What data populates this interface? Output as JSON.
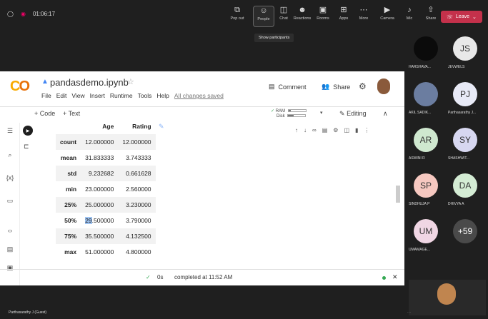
{
  "meeting": {
    "timer": "01:06:17",
    "tools": [
      {
        "icon": "pop-out-icon",
        "glyph": "⧉",
        "label": "Pop out"
      },
      {
        "icon": "people-icon",
        "glyph": "☺",
        "label": "People"
      },
      {
        "icon": "chat-icon",
        "glyph": "◫",
        "label": "Chat"
      },
      {
        "icon": "reactions-icon",
        "glyph": "☻",
        "label": "Reactions"
      },
      {
        "icon": "rooms-icon",
        "glyph": "▣",
        "label": "Rooms"
      },
      {
        "icon": "apps-icon",
        "glyph": "⊞",
        "label": "Apps"
      },
      {
        "icon": "more-icon",
        "glyph": "⋯",
        "label": "More"
      },
      {
        "icon": "camera-icon",
        "glyph": "▶",
        "label": "Camera"
      },
      {
        "icon": "mic-icon",
        "glyph": "♪",
        "label": "Mic"
      },
      {
        "icon": "share-icon",
        "glyph": "⇧",
        "label": "Share"
      }
    ],
    "leave_label": "Leave",
    "tooltip": "Show participants",
    "presenter_label": "Parthasarathy J (Guest)"
  },
  "colab": {
    "title": "pandasdemo.ipynb",
    "menu": [
      "File",
      "Edit",
      "View",
      "Insert",
      "Runtime",
      "Tools",
      "Help"
    ],
    "save_status": "All changes saved",
    "comment_label": "Comment",
    "share_label": "Share",
    "add_code": "+ Code",
    "add_text": "+ Text",
    "ram_label": "RAM",
    "disk_label": "Disk",
    "ram_level": 0.15,
    "disk_level": 0.3,
    "editing_label": "Editing",
    "table": {
      "columns": [
        "Age",
        "Rating"
      ],
      "rows": [
        {
          "stat": "count",
          "age": "12.000000",
          "rating": "12.000000"
        },
        {
          "stat": "mean",
          "age": "31.833333",
          "rating": "3.743333"
        },
        {
          "stat": "std",
          "age": "9.232682",
          "rating": "0.661628"
        },
        {
          "stat": "min",
          "age": "23.000000",
          "rating": "2.560000"
        },
        {
          "stat": "25%",
          "age": "25.000000",
          "rating": "3.230000"
        },
        {
          "stat": "50%",
          "age_highlight": "29",
          "age_rest": ".500000",
          "rating": "3.790000"
        },
        {
          "stat": "75%",
          "age": "35.500000",
          "rating": "4.132500"
        },
        {
          "stat": "max",
          "age": "51.000000",
          "rating": "4.800000"
        }
      ]
    },
    "status_time": "0s",
    "status_text": "completed at 11:52 AM"
  },
  "participants": [
    {
      "initials": "",
      "name": "HARSHAVA...",
      "color": "#0b0b0b"
    },
    {
      "initials": "JS",
      "name": "JEVWELS",
      "color": "#e8e8e8"
    },
    {
      "initials": "",
      "name": "AKIL SADIK...",
      "color": "#6b7da0"
    },
    {
      "initials": "PJ",
      "name": "Parthasarathy J...",
      "color": "#e8eaf6"
    },
    {
      "initials": "AR",
      "name": "ASWINI R",
      "color": "#cfe8cf"
    },
    {
      "initials": "SY",
      "name": "SHASHWIT...",
      "color": "#d7d7f0"
    },
    {
      "initials": "SP",
      "name": "SINDHUJA P",
      "color": "#f6c8c0"
    },
    {
      "initials": "DA",
      "name": "DHIVYA A",
      "color": "#d4ecd4"
    },
    {
      "initials": "UM",
      "name": "UMAMAGE...",
      "color": "#f0d6e4"
    },
    {
      "initials": "+59",
      "name": "",
      "color": "#4a4a4a"
    }
  ]
}
